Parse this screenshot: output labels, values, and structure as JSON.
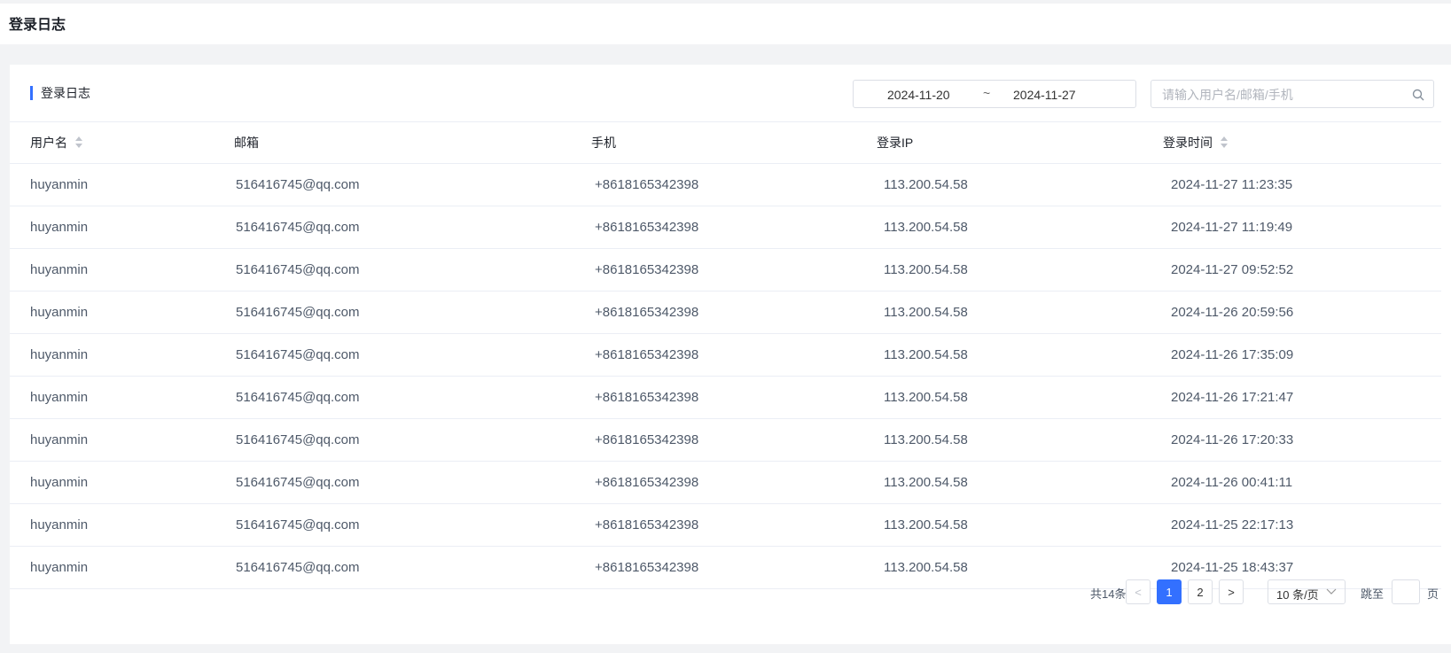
{
  "header": {
    "title": "登录日志"
  },
  "panel": {
    "title": "登录日志",
    "date_range": {
      "start": "2024-11-20",
      "separator": "~",
      "end": "2024-11-27"
    },
    "search": {
      "placeholder": "请输入用户名/邮箱/手机",
      "value": ""
    }
  },
  "table": {
    "columns": [
      "用户名",
      "邮箱",
      "手机",
      "登录IP",
      "登录时间"
    ],
    "rows": [
      [
        "huyanmin",
        "516416745@qq.com",
        "+8618165342398",
        "113.200.54.58",
        "2024-11-27 11:23:35"
      ],
      [
        "huyanmin",
        "516416745@qq.com",
        "+8618165342398",
        "113.200.54.58",
        "2024-11-27 11:19:49"
      ],
      [
        "huyanmin",
        "516416745@qq.com",
        "+8618165342398",
        "113.200.54.58",
        "2024-11-27 09:52:52"
      ],
      [
        "huyanmin",
        "516416745@qq.com",
        "+8618165342398",
        "113.200.54.58",
        "2024-11-26 20:59:56"
      ],
      [
        "huyanmin",
        "516416745@qq.com",
        "+8618165342398",
        "113.200.54.58",
        "2024-11-26 17:35:09"
      ],
      [
        "huyanmin",
        "516416745@qq.com",
        "+8618165342398",
        "113.200.54.58",
        "2024-11-26 17:21:47"
      ],
      [
        "huyanmin",
        "516416745@qq.com",
        "+8618165342398",
        "113.200.54.58",
        "2024-11-26 17:20:33"
      ],
      [
        "huyanmin",
        "516416745@qq.com",
        "+8618165342398",
        "113.200.54.58",
        "2024-11-26 00:41:11"
      ],
      [
        "huyanmin",
        "516416745@qq.com",
        "+8618165342398",
        "113.200.54.58",
        "2024-11-25 22:17:13"
      ],
      [
        "huyanmin",
        "516416745@qq.com",
        "+8618165342398",
        "113.200.54.58",
        "2024-11-25 18:43:37"
      ]
    ]
  },
  "pagination": {
    "total": "共14条",
    "prev": "<",
    "pages": [
      "1",
      "2"
    ],
    "current": "1",
    "next": ">",
    "page_size": "10 条/页",
    "jump_label": "跳至",
    "page_label": "页"
  },
  "colors": {
    "accent": "#3370ff",
    "border": "#dcdfe6",
    "background": "#f2f3f5"
  },
  "icons": {
    "search": "search-icon",
    "sort": "sort-icon",
    "dropdown": "chevron-down-icon"
  }
}
